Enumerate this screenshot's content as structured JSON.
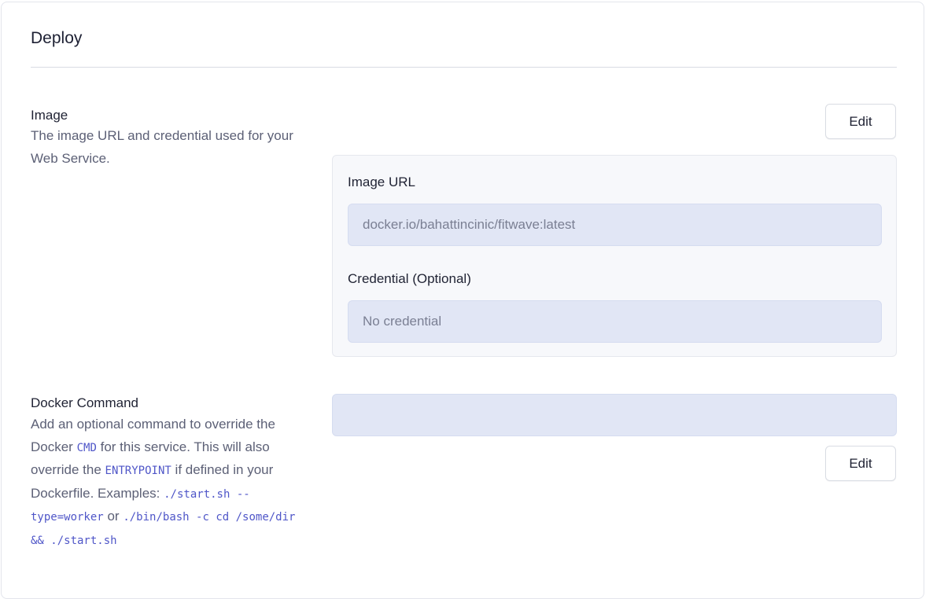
{
  "deploy": {
    "title": "Deploy"
  },
  "image_section": {
    "title": "Image",
    "description": "The image URL and credential used for your Web Service.",
    "edit_label": "Edit",
    "image_url_label": "Image URL",
    "image_url_value": "docker.io/bahattincinic/fitwave:latest",
    "credential_label": "Credential (Optional)",
    "credential_value": "No credential"
  },
  "docker_command_section": {
    "title": "Docker Command",
    "description_1": "Add an optional command to override the Docker",
    "code_cmd": "CMD",
    "description_2": "for this service. This will also override the",
    "code_entrypoint": "ENTRYPOINT",
    "description_3": "if defined in your Dockerfile. Examples:",
    "code_example_1": "./start.sh --type=worker",
    "description_4": "or",
    "code_example_2": "./bin/bash -c cd /some/dir && ./start.sh",
    "command_value": "",
    "edit_label": "Edit"
  }
}
